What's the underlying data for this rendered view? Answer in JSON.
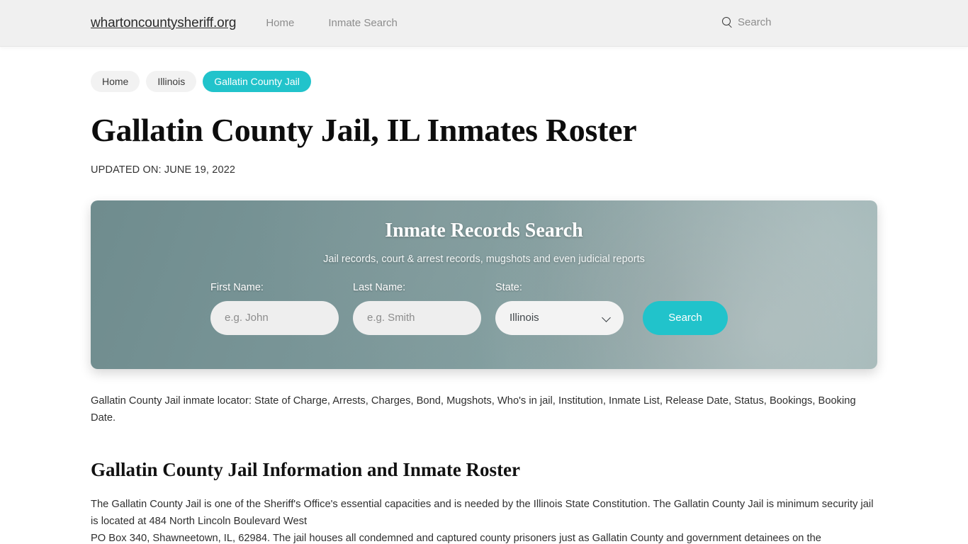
{
  "header": {
    "brand": "whartoncountysheriff.org",
    "nav": [
      {
        "label": "Home"
      },
      {
        "label": "Inmate Search"
      }
    ],
    "search_label": "Search",
    "search_icon": "search-icon"
  },
  "breadcrumb": [
    {
      "label": "Home",
      "active": false
    },
    {
      "label": "Illinois",
      "active": false
    },
    {
      "label": "Gallatin County Jail",
      "active": true
    }
  ],
  "page": {
    "title": "Gallatin County Jail, IL Inmates Roster",
    "updated": "UPDATED ON: JUNE 19, 2022"
  },
  "hero": {
    "title": "Inmate Records Search",
    "subtitle": "Jail records, court & arrest records, mugshots and even judicial reports",
    "fields": {
      "first_name_label": "First Name:",
      "first_name_placeholder": "e.g. John",
      "first_name_value": "",
      "last_name_label": "Last Name:",
      "last_name_placeholder": "e.g. Smith",
      "last_name_value": "",
      "state_label": "State:",
      "state_value": "Illinois"
    },
    "submit_label": "Search"
  },
  "content": {
    "lede": "Gallatin County Jail inmate locator: State of Charge, Arrests, Charges, Bond, Mugshots, Who's in jail, Institution, Inmate List, Release Date, Status, Bookings, Booking Date.",
    "section_title": "Gallatin County Jail Information and Inmate Roster",
    "paragraph_line_1": "The Gallatin County Jail is one of the Sheriff's Office's essential capacities and is needed by the Illinois State Constitution. The Gallatin County Jail is minimum security jail is located at 484 North Lincoln Boulevard West",
    "paragraph_line_2": "PO Box 340, Shawneetown, IL, 62984. The jail houses all condemned and captured county prisoners just as Gallatin County and government detainees on the"
  },
  "colors": {
    "accent_teal": "#21c3cb",
    "header_bg": "#f0f0f0",
    "hero_base": "#7b9799"
  }
}
